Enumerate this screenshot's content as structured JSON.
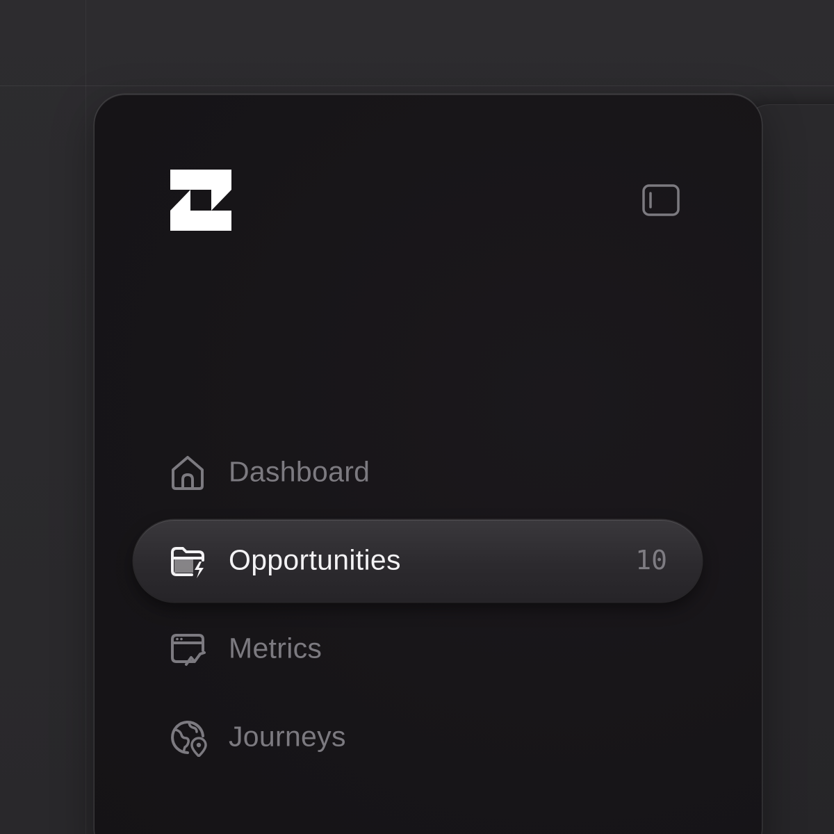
{
  "brand": {
    "logo_icon": "z-block-logo"
  },
  "header": {
    "collapse_icon": "sidebar-toggle-icon"
  },
  "nav": {
    "items": [
      {
        "label": "Dashboard",
        "icon": "home-icon",
        "active": false
      },
      {
        "label": "Opportunities",
        "icon": "folder-bolt-icon",
        "active": true,
        "count": "10"
      },
      {
        "label": "Metrics",
        "icon": "browser-chart-icon",
        "active": false
      },
      {
        "label": "Journeys",
        "icon": "globe-pin-icon",
        "active": false
      }
    ]
  },
  "colors": {
    "background": "#2b2a2d",
    "sidebar": "#171518",
    "active_text": "#f3f2f4",
    "inactive_text": "#7c7a80"
  }
}
